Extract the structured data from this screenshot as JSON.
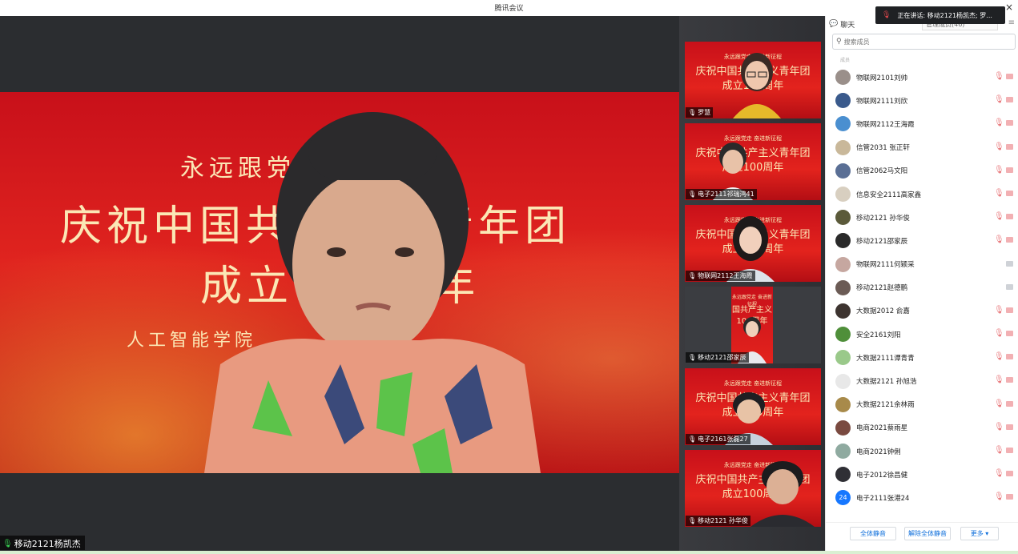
{
  "window": {
    "title": "腾讯会议",
    "close_glyph": "×"
  },
  "main_video": {
    "speaker_label": "移动2121杨凯杰",
    "bg_lines": [
      "永远跟党走",
      "庆祝中国共产主义青年团",
      "成立100周年",
      "人工智能学院"
    ]
  },
  "thumbnails": [
    {
      "label": "罗慧",
      "bg_small": "永远跟党走 奋进新征程",
      "bg_line1": "庆祝中国共产主义青年团",
      "bg_line2": "成立100周年"
    },
    {
      "label": "电子2111祁瑞鸿41",
      "bg_small": "永远跟党走 奋进新征程",
      "bg_line1": "庆祝中国共产主义青年团",
      "bg_line2": "成立100周年"
    },
    {
      "label": "物联网2112王海霞",
      "bg_small": "永远跟党走 奋进新征程",
      "bg_line1": "庆祝中国共产主义青年团",
      "bg_line2": "成立100周年"
    },
    {
      "label": "移动2121邵家辰",
      "bg_small": "永远跟党走 奋进新征程",
      "bg_line1": "国共产主义",
      "bg_line2": "100周年"
    },
    {
      "label": "电子2161张磊27",
      "bg_small": "永远跟党走 奋进新征程",
      "bg_line1": "庆祝中国共产主义青年团",
      "bg_line2": "成立100周年"
    },
    {
      "label": "移动2121 孙华俊",
      "bg_small": "永远跟党走 奋进新征程",
      "bg_line1": "庆祝中国共产主义青年团",
      "bg_line2": "成立100周年"
    }
  ],
  "panel": {
    "chat_tab": "聊天",
    "members_tab": "管理成员(46)",
    "search_placeholder": "搜索成员",
    "group_label": "成员",
    "members": [
      {
        "name": "物联网2101刘帅",
        "avatar_color": "#9a8f8a",
        "mic": "muted",
        "cam": "off"
      },
      {
        "name": "物联网2111刘欣",
        "avatar_color": "#3a5a8c",
        "mic": "muted",
        "cam": "off"
      },
      {
        "name": "物联网2112王海霞",
        "avatar_color": "#4a8fd0",
        "mic": "muted",
        "cam": "off"
      },
      {
        "name": "信管2031 张正轩",
        "avatar_color": "#c9b89a",
        "mic": "muted",
        "cam": "off"
      },
      {
        "name": "信管2062马文阳",
        "avatar_color": "#5a6f95",
        "mic": "muted",
        "cam": "off"
      },
      {
        "name": "信息安全2111高家鑫",
        "avatar_color": "#d8cfc0",
        "mic": "muted",
        "cam": "off"
      },
      {
        "name": "移动2121 孙华俊",
        "avatar_color": "#5b5a3a",
        "mic": "muted",
        "cam": "off"
      },
      {
        "name": "移动2121邵家辰",
        "avatar_color": "#2a2a2a",
        "mic": "muted",
        "cam": "off"
      },
      {
        "name": "物联网2111何颖采",
        "avatar_color": "#c6a7a0",
        "mic": "none",
        "cam": "grey"
      },
      {
        "name": "移动2121赵德鹏",
        "avatar_color": "#6b5b55",
        "mic": "none",
        "cam": "grey"
      },
      {
        "name": "大数据2012 俞嘉",
        "avatar_color": "#3d3430",
        "mic": "muted",
        "cam": "off"
      },
      {
        "name": "安全2161刘阳",
        "avatar_color": "#4f8f3a",
        "mic": "muted",
        "cam": "off"
      },
      {
        "name": "大数据2111谭青青",
        "avatar_color": "#9ac98a",
        "mic": "muted",
        "cam": "off"
      },
      {
        "name": "大数据2121 孙旭浩",
        "avatar_color": "#e8e8e8",
        "mic": "muted",
        "cam": "off"
      },
      {
        "name": "大数据2121余林雨",
        "avatar_color": "#a88a4a",
        "mic": "muted",
        "cam": "off"
      },
      {
        "name": "电商2021蔡雨星",
        "avatar_color": "#7a4a40",
        "mic": "muted",
        "cam": "off"
      },
      {
        "name": "电商2021钟俐",
        "avatar_color": "#8faaa0",
        "mic": "muted",
        "cam": "off"
      },
      {
        "name": "电子2012徐昌健",
        "avatar_color": "#2f2f35",
        "mic": "muted",
        "cam": "off"
      },
      {
        "name": "电子2111张港24",
        "avatar_color": "#1677ff",
        "avatar_text": "24",
        "mic": "muted",
        "cam": "off"
      }
    ],
    "buttons": {
      "mute_all": "全体静音",
      "unmute_all": "解除全体静音",
      "more": "更多 ▾"
    }
  },
  "toast": {
    "text": "正在讲话: 移动2121杨凯杰; 罗..."
  },
  "colors": {
    "accent": "#0f6fdb",
    "muted_red": "#e0474c"
  }
}
